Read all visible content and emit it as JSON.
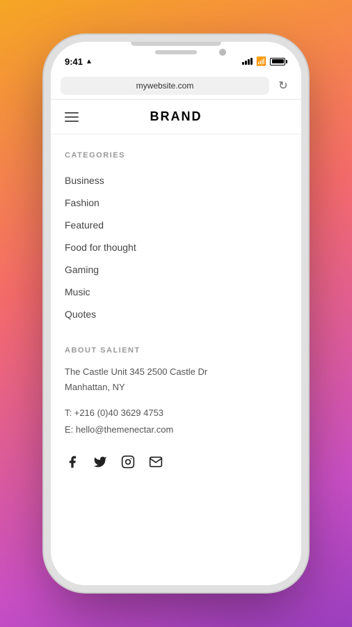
{
  "phone": {
    "time": "9:41",
    "location_arrow": "▲"
  },
  "browser": {
    "url": "mywebsite.com",
    "refresh_icon": "↻"
  },
  "header": {
    "brand": "BRAND",
    "hamburger_label": "Menu"
  },
  "categories": {
    "section_label": "CATEGORIES",
    "items": [
      {
        "label": "Business"
      },
      {
        "label": "Fashion"
      },
      {
        "label": "Featured"
      },
      {
        "label": "Food for thought"
      },
      {
        "label": "Gaming"
      },
      {
        "label": "Music"
      },
      {
        "label": "Quotes"
      }
    ]
  },
  "about": {
    "section_label": "ABOUT SALIENT",
    "address_line1": "The Castle Unit 345 2500 Castle Dr",
    "address_line2": "Manhattan, NY",
    "phone": "T: +216 (0)40 3629 4753",
    "email": "E: hello@themenectar.com"
  },
  "social": {
    "facebook": "f",
    "twitter": "twitter",
    "instagram": "instagram",
    "mail": "mail"
  }
}
